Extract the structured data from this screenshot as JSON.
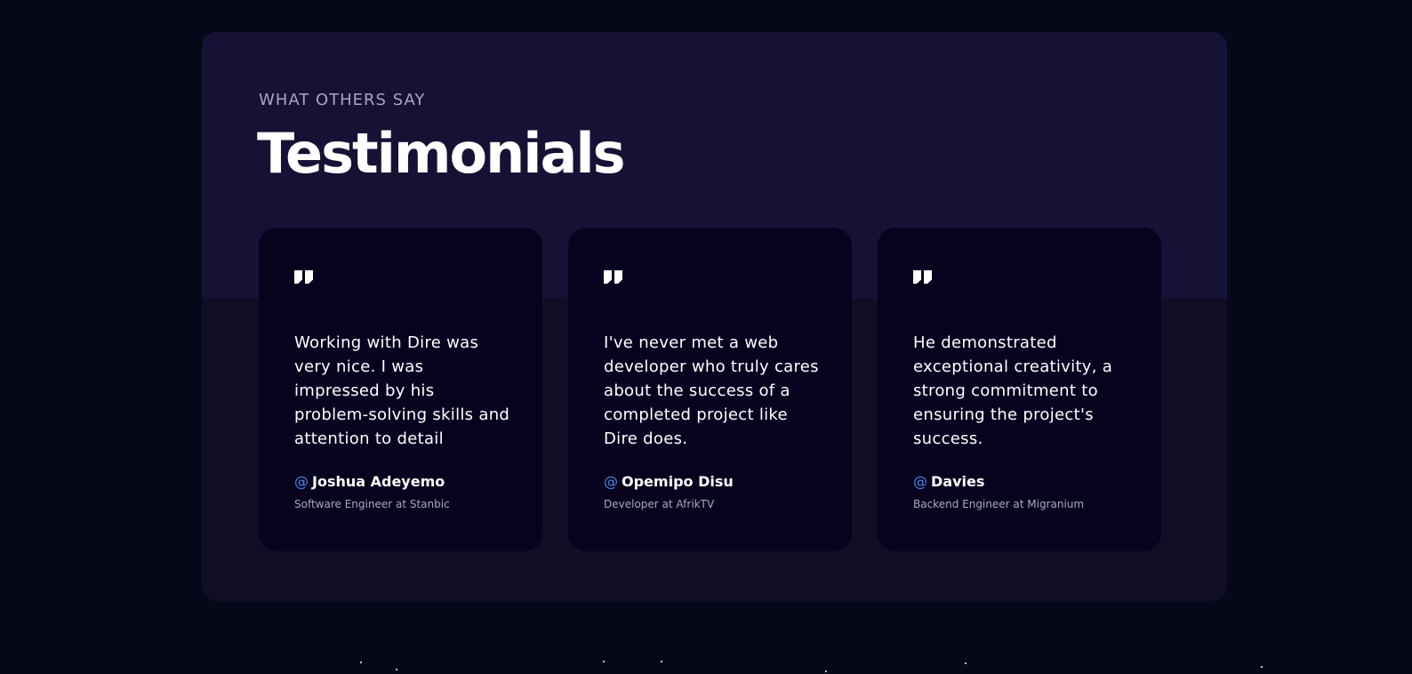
{
  "section": {
    "subtitle": "WHAT OTHERS SAY",
    "title": "Testimonials"
  },
  "testimonials": [
    {
      "quote": "Working with Dire was very nice. I was impressed by his problem-solving skills and attention to detail",
      "at_symbol": "@",
      "name": "Joshua Adeyemo",
      "role": "Software Engineer at Stanbic"
    },
    {
      "quote": "I've never met a web developer who truly cares about the success of a completed project like Dire does.",
      "at_symbol": "@",
      "name": "Opemipo Disu",
      "role": "Developer at AfrikTV"
    },
    {
      "quote": "He demonstrated exceptional creativity, a strong commitment to ensuring the project's success.",
      "at_symbol": "@",
      "name": "Davies",
      "role": "Backend Engineer at Migranium"
    }
  ],
  "icons": {
    "quote": "quote-icon",
    "star": "star-dot"
  },
  "colors": {
    "page_background": "#050818",
    "section_background": "#100d24",
    "section_header_background": "#151236",
    "card_background": "#07031f",
    "accent": "#4c88ea"
  }
}
